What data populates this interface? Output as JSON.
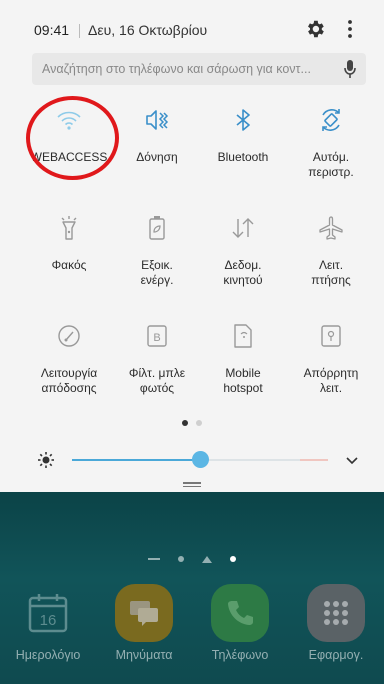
{
  "status": {
    "time": "09:41",
    "date": "Δευ, 16 Οκτωβρίου"
  },
  "search": {
    "placeholder": "Αναζήτηση στο τηλέφωνο και σάρωση για κοντ..."
  },
  "tiles": [
    {
      "label": "WEBACCESS",
      "icon": "wifi-icon"
    },
    {
      "label": "Δόνηση",
      "icon": "vibrate-icon"
    },
    {
      "label": "Bluetooth",
      "icon": "bluetooth-icon"
    },
    {
      "label": "Αυτόμ.\nπεριστρ.",
      "icon": "auto-rotate-icon"
    },
    {
      "label": "Φακός",
      "icon": "flashlight-icon"
    },
    {
      "label": "Εξοικ.\nενέργ.",
      "icon": "battery-saver-icon"
    },
    {
      "label": "Δεδομ.\nκινητού",
      "icon": "mobile-data-icon"
    },
    {
      "label": "Λειτ.\nπτήσης",
      "icon": "airplane-icon"
    },
    {
      "label": "Λειτουργία\nαπόδοσης",
      "icon": "performance-icon"
    },
    {
      "label": "Φίλτ. μπλε\nφωτός",
      "icon": "blue-light-filter-icon"
    },
    {
      "label": "Mobile\nhotspot",
      "icon": "hotspot-icon"
    },
    {
      "label": "Απόρρητη\nλειτ.",
      "icon": "private-mode-icon"
    }
  ],
  "quick_panel": {
    "page_count": 2,
    "active_page": 1
  },
  "brightness": {
    "level": 0.5
  },
  "colors": {
    "accent": "#4aa8d8",
    "panel_bg": "#f4f4f4",
    "highlight_circle": "#e0181b"
  },
  "dock": [
    {
      "label": "Ημερολόγιο",
      "icon": "calendar-icon",
      "day": "16"
    },
    {
      "label": "Μηνύματα",
      "icon": "messages-icon"
    },
    {
      "label": "Τηλέφωνο",
      "icon": "phone-icon"
    },
    {
      "label": "Εφαρμογ.",
      "icon": "apps-icon"
    }
  ]
}
